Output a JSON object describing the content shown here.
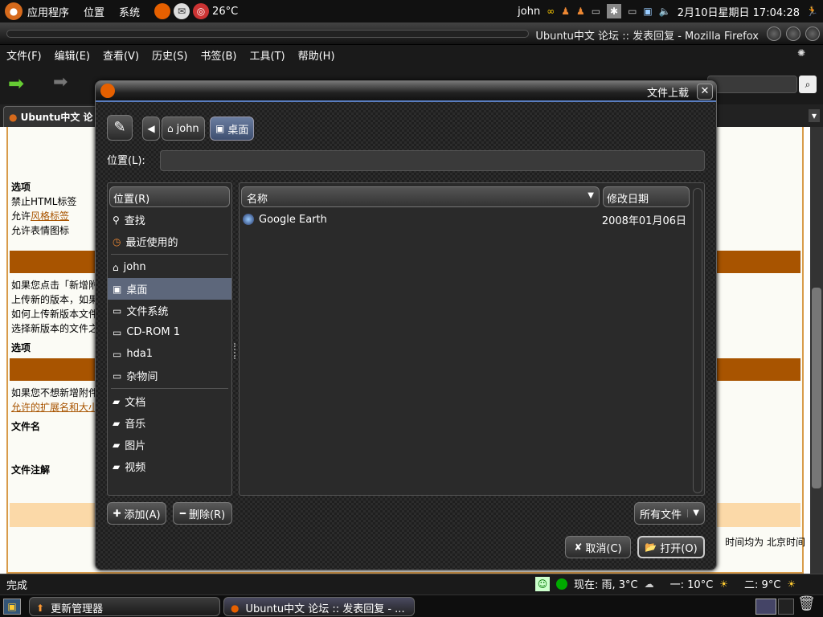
{
  "top_panel": {
    "menus": [
      "应用程序",
      "位置",
      "系统"
    ],
    "temperature": "26°C",
    "user": "john",
    "datetime": "2月10日星期日 17:04:28"
  },
  "firefox": {
    "window_title": "Ubuntu中文 论坛 :: 发表回复 - Mozilla Firefox",
    "menu": [
      "文件(F)",
      "编辑(E)",
      "查看(V)",
      "历史(S)",
      "书签(B)",
      "工具(T)",
      "帮助(H)"
    ],
    "tab_label": "Ubuntu中文 论",
    "status": "完成",
    "weather": {
      "now": "现在: 雨, 3°C",
      "mon": "一: 10°C",
      "tue": "二: 9°C"
    }
  },
  "page": {
    "options1": "选项",
    "l1": "禁止HTML标签",
    "l2_a": "允许",
    "l2_b": "风格标签",
    "l3": "允许表情图标",
    "p1": "如果您点击「新增附",
    "p2": "上传新的版本，如果",
    "p3": "如何上传新版本文件",
    "p4": "选择新版本的文件之",
    "options2": "选项",
    "p5": "如果您不想新增附件",
    "p6": "允许的扩展名和大小",
    "file_name": "文件名",
    "file_comment": "文件注解",
    "timezone_note": "时间均为 北京时间"
  },
  "dialog": {
    "title": "文件上载",
    "crumbs": [
      "john",
      "桌面"
    ],
    "location_label": "位置(L):",
    "location_value": "",
    "places_header": "位置(R)",
    "places": [
      "查找",
      "最近使用的",
      "john",
      "桌面",
      "文件系统",
      "CD-ROM 1",
      "hda1",
      "杂物间",
      "文档",
      "音乐",
      "图片",
      "视频"
    ],
    "name_header": "名称",
    "date_header": "修改日期",
    "files": [
      {
        "name": "Google Earth",
        "date": "2008年01月06日"
      }
    ],
    "add": "添加(A)",
    "remove": "删除(R)",
    "filter": "所有文件",
    "cancel": "取消(C)",
    "open": "打开(O)"
  },
  "taskbar": [
    "更新管理器",
    "Ubuntu中文 论坛 :: 发表回复 - ..."
  ],
  "colors": {
    "accent": "#a85400",
    "selection": "#5d677b"
  }
}
